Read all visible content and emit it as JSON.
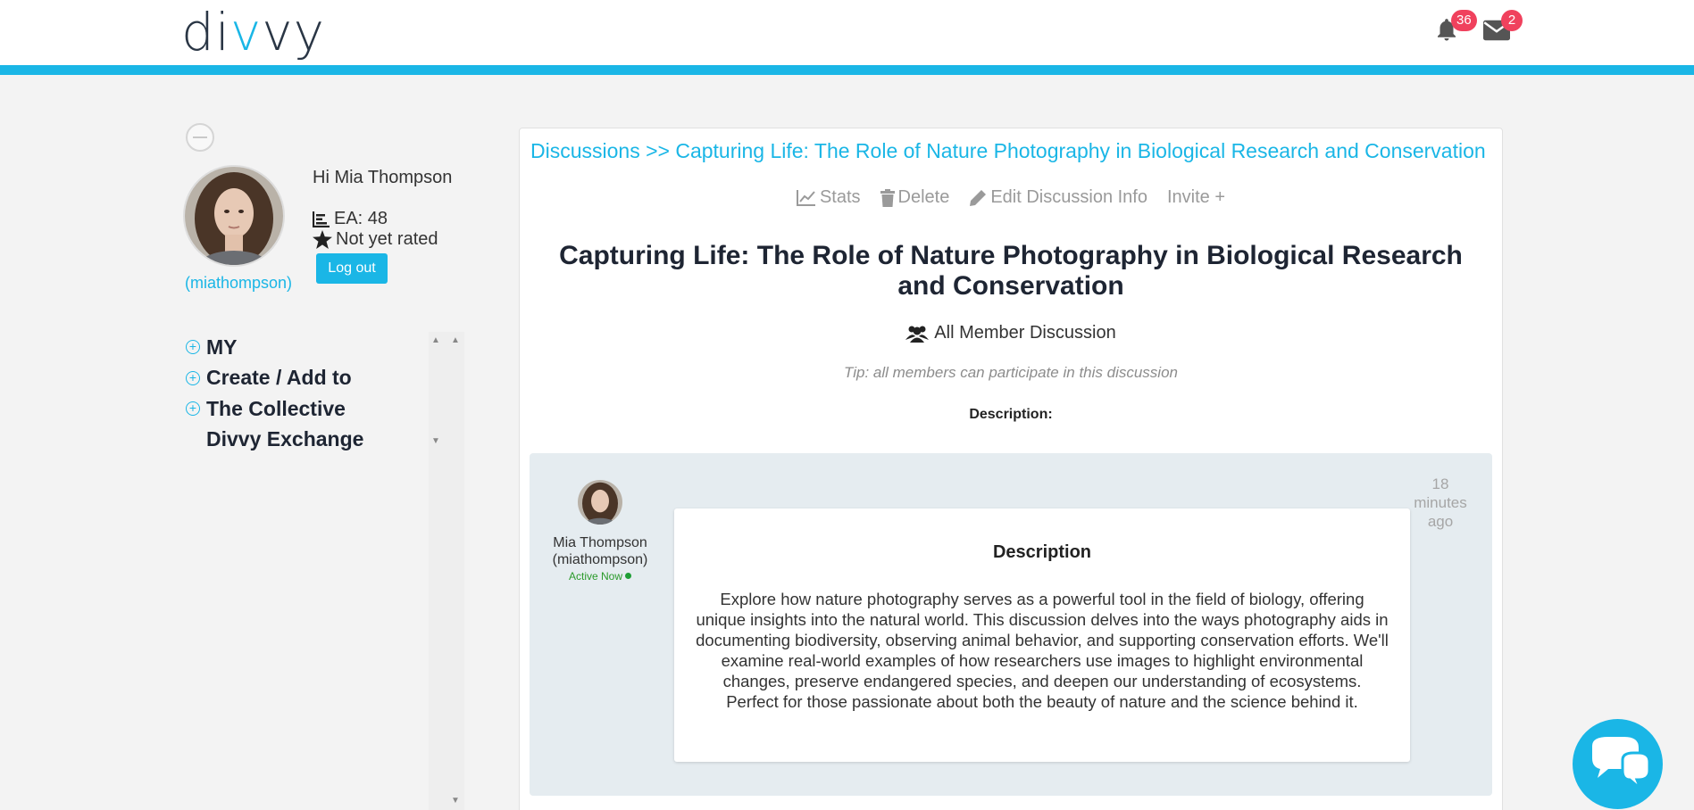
{
  "header": {
    "logo_text": "divvy",
    "notifications_count": "36",
    "messages_count": "2",
    "accent_color": "#1ab6e6",
    "badge_color": "#f0415d"
  },
  "profile": {
    "greeting": "Hi Mia Thompson",
    "ea": "EA: 48",
    "rating": "Not yet rated",
    "username": "(miathompson)",
    "logout_label": "Log out"
  },
  "sidebar": {
    "items": [
      {
        "label": "MY",
        "has_icon": true
      },
      {
        "label": "Create / Add to",
        "has_icon": true
      },
      {
        "label": "The Collective",
        "has_icon": true
      },
      {
        "label": "Divvy Exchange",
        "has_icon": false
      }
    ]
  },
  "discussion": {
    "breadcrumb": "Discussions >> Capturing Life: The Role of Nature Photography in Biological Research and Conservation",
    "actions": {
      "stats": "Stats",
      "delete": "Delete",
      "edit": "Edit Discussion Info",
      "invite": "Invite +"
    },
    "title": "Capturing Life: The Role of Nature Photography in Biological Research and Conservation",
    "type_label": "All Member Discussion",
    "tip": "Tip: all members can participate in this discussion",
    "description_label": "Description:"
  },
  "post": {
    "author_name": "Mia Thompson",
    "author_username": "(miathompson)",
    "status": "Active Now",
    "time_ago": "18 minutes ago",
    "title": "Description",
    "body": "Explore how nature photography serves as a powerful tool in the field of biology, offering unique insights into the natural world. This discussion delves into the ways photography aids in documenting biodiversity, observing animal behavior, and supporting conservation efforts. We'll examine real-world examples of how researchers use images to highlight environmental changes, preserve endangered species, and deepen our understanding of ecosystems. Perfect for those passionate about both the beauty of nature and the science behind it."
  }
}
